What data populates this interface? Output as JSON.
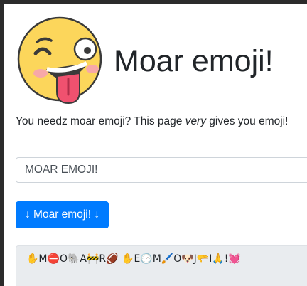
{
  "header": {
    "title": "Moar emoji!",
    "logo_icon": "winking-tongue-face-icon"
  },
  "tagline": {
    "before": "You needz moar emoji? This page ",
    "emphasis": "very",
    "after": " gives you emoji!"
  },
  "input": {
    "value": "MOAR EMOJI!"
  },
  "button": {
    "label": "↓ Moar emoji! ↓",
    "color": "#007bff"
  },
  "output": {
    "text": "✋M⛔O🐘A🚧R🏈 ✋E🕑M🖌️O🐶J🫳I🙏!💓"
  }
}
